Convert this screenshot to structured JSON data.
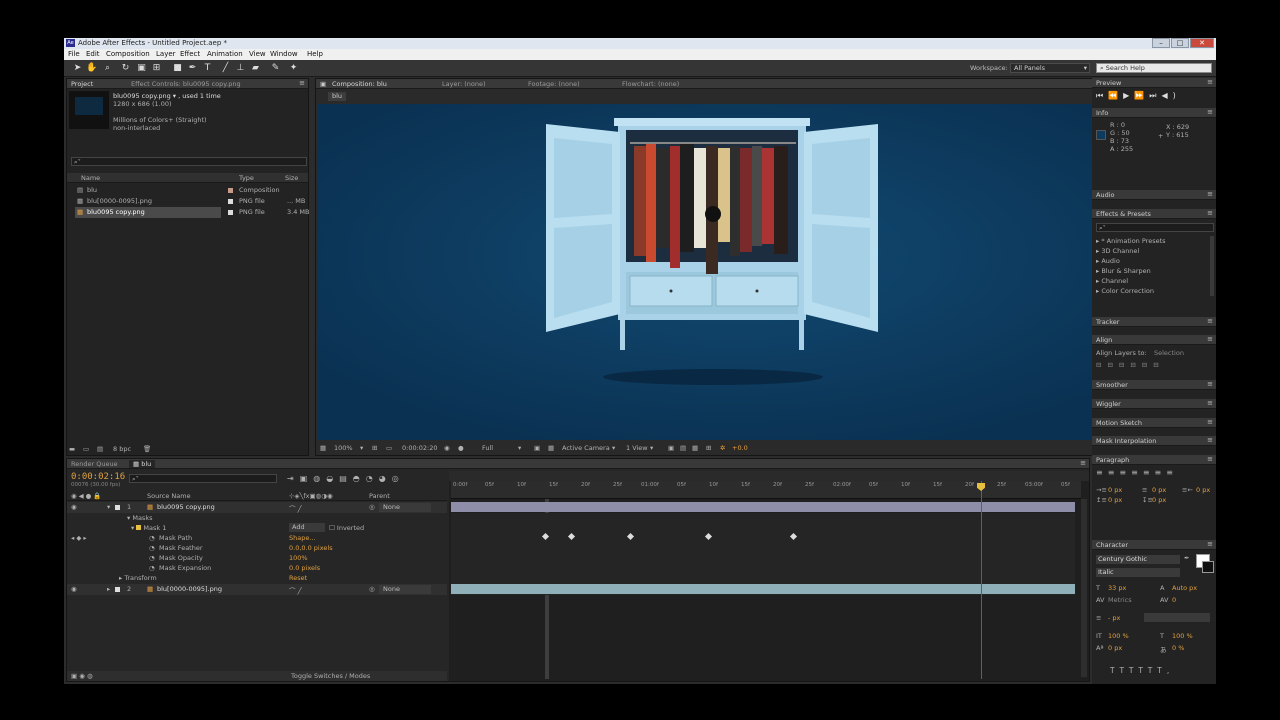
{
  "window": {
    "title": "Adobe After Effects - Untitled Project.aep *",
    "min": "–",
    "max": "□",
    "close": "✕"
  },
  "menu": [
    "File",
    "Edit",
    "Composition",
    "Layer",
    "Effect",
    "Animation",
    "View",
    "Window",
    "Help"
  ],
  "toolbar": {
    "workspace_label": "Workspace:",
    "workspace_value": "All Panels",
    "search_placeholder": "Search Help"
  },
  "project_panel": {
    "tab": "Project",
    "tab2": "Effect Controls: blu0095 copy.png",
    "item_name": "blu0095 copy.png ▾ , used 1 time",
    "item_dims": "1280 x 686 (1.00)",
    "item_color": "Millions of Colors+ (Straight)",
    "item_interlace": "non-interlaced",
    "columns": {
      "name": "Name",
      "type": "Type",
      "size": "Size"
    },
    "items": [
      {
        "name": "blu",
        "type": "Composition",
        "size": ""
      },
      {
        "name": "blu[0000-0095].png",
        "type": "PNG file",
        "size": "... MB"
      },
      {
        "name": "blu0095 copy.png",
        "type": "PNG file",
        "size": "3.4 MB"
      }
    ],
    "bpc": "8 bpc"
  },
  "comp_panel": {
    "tab": "Composition: blu",
    "tab_layer": "Layer: (none)",
    "tab_footage": "Footage: (none)",
    "tab_flowchart": "Flowchart: (none)",
    "breadcrumb": "blu",
    "zoom": "100%",
    "timecode": "0:00:02:20",
    "resolution": "Full",
    "camera": "Active Camera",
    "view": "1 View",
    "exposure": "+0.0"
  },
  "right": {
    "preview": "Preview",
    "info": "Info",
    "info_r": "R : 0",
    "info_g": "G : 50",
    "info_b": "B : 73",
    "info_a": "A : 255",
    "info_x": "X : 629",
    "info_y": "Y : 615",
    "audio": "Audio",
    "effects_presets": "Effects & Presets",
    "effects_list": [
      "* Animation Presets",
      "3D Channel",
      "Audio",
      "Blur & Sharpen",
      "Channel",
      "Color Correction"
    ],
    "tracker": "Tracker",
    "align": "Align",
    "align_layers": "Align Layers to:",
    "align_target": "Selection",
    "smoother": "Smoother",
    "wiggler": "Wiggler",
    "motion_sketch": "Motion Sketch",
    "mask_interp": "Mask Interpolation",
    "paragraph": "Paragraph",
    "para_vals": [
      "0 px",
      "0 px",
      "0 px",
      "0 px",
      "0 px"
    ],
    "character": "Character",
    "font": "Century Gothic",
    "style": "Italic",
    "font_size": "33 px",
    "leading": "Auto px",
    "kerning": "Metrics",
    "tracking": "0",
    "stroke": "- px",
    "vscale": "100 %",
    "hscale": "100 %",
    "baseline": "0 px",
    "tsume": "0 %"
  },
  "timeline": {
    "tab_render": "Render Queue",
    "tab_comp": "blu",
    "timecode": "0:00:02:16",
    "frames": "00076 (30.00 fps)",
    "col_source": "Source Name",
    "col_parent": "Parent",
    "layers": [
      {
        "num": "1",
        "name": "blu0095 copy.png",
        "parent": "None"
      },
      {
        "num": "2",
        "name": "blu[0000-0095].png",
        "parent": "None"
      }
    ],
    "masks": "Masks",
    "mask1": "Mask 1",
    "mask_mode": "Add",
    "inverted": "Inverted",
    "props": [
      {
        "name": "Mask Path",
        "value": "Shape..."
      },
      {
        "name": "Mask Feather",
        "value": "0.0,0.0 pixels"
      },
      {
        "name": "Mask Opacity",
        "value": "100%"
      },
      {
        "name": "Mask Expansion",
        "value": "0.0 pixels"
      }
    ],
    "transform": "Transform",
    "transform_value": "Reset",
    "toggle": "Toggle Switches / Modes",
    "ruler": [
      "0:00f",
      "05f",
      "10f",
      "15f",
      "20f",
      "25f",
      "01:00f",
      "05f",
      "10f",
      "15f",
      "20f",
      "25f",
      "02:00f",
      "05f",
      "10f",
      "15f",
      "20f",
      "25f",
      "03:00f",
      "05f"
    ]
  },
  "colors": {
    "comp_bg": "#0d3b60",
    "accent": "#e0a040",
    "layer_bar1": "#8f8ea8",
    "layer_bar2": "#8fb0b8"
  }
}
